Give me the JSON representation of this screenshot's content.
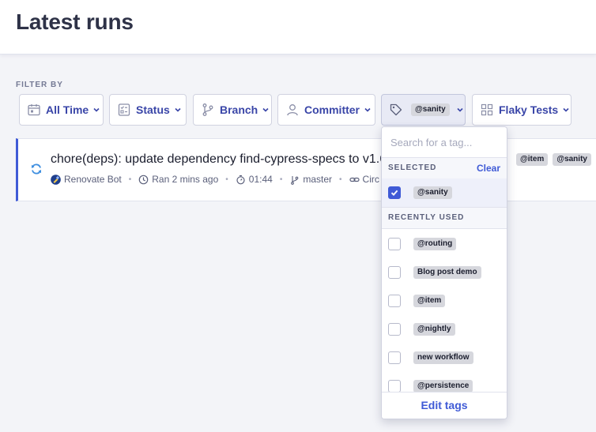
{
  "page": {
    "title": "Latest runs"
  },
  "filters": {
    "label": "FILTER BY",
    "all_time": "All Time",
    "status": "Status",
    "branch": "Branch",
    "committer": "Committer",
    "tag_selected": "@sanity",
    "flaky_tests": "Flaky Tests"
  },
  "run": {
    "title": "chore(deps): update dependency find-cypress-specs to v1.6",
    "author": "Renovate Bot",
    "ran": "Ran 2 mins ago",
    "duration": "01:44",
    "branch": "master",
    "ci": "Circ",
    "tags": [
      "@item",
      "@sanity"
    ]
  },
  "tag_dropdown": {
    "search_placeholder": "Search for a tag...",
    "selected_header": "SELECTED",
    "clear_label": "Clear",
    "selected": [
      {
        "label": "@sanity",
        "checked": true
      }
    ],
    "recent_header": "RECENTLY USED",
    "recent": [
      {
        "label": "@routing",
        "checked": false
      },
      {
        "label": "Blog post demo",
        "checked": false
      },
      {
        "label": "@item",
        "checked": false
      },
      {
        "label": "@nightly",
        "checked": false
      },
      {
        "label": "new workflow",
        "checked": false
      },
      {
        "label": "@persistence",
        "checked": false
      }
    ],
    "edit_tags": "Edit tags"
  },
  "colors": {
    "accent": "#3f5ad6",
    "filter_text": "#3a46a8",
    "title_text": "#2e3247",
    "tag_chip_bg": "#d6d7dd"
  }
}
